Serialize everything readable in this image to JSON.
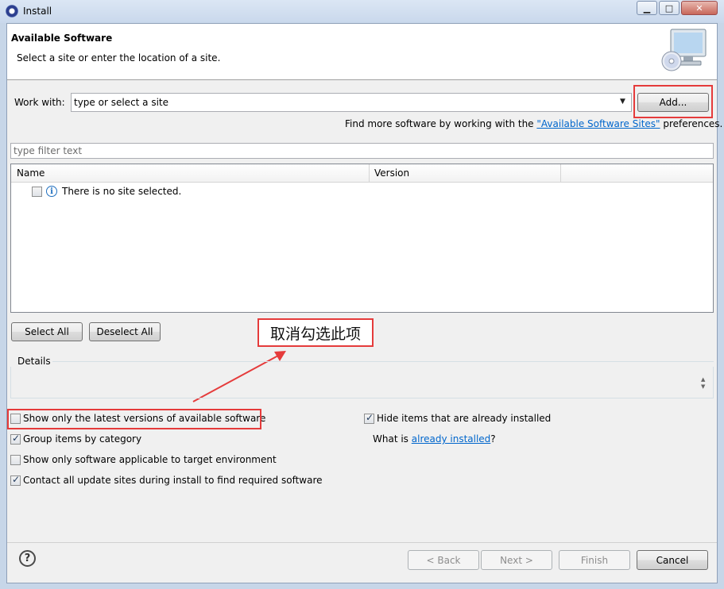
{
  "window": {
    "title": "Install"
  },
  "header": {
    "title": "Available Software",
    "description": "Select a site or enter the location of a site."
  },
  "work_with": {
    "label": "Work with:",
    "value": "type or select a site",
    "add_button": "Add..."
  },
  "find_more": {
    "prefix": "Find more software by working with the ",
    "link": "\"Available Software Sites\"",
    "suffix": " preferences."
  },
  "filter": {
    "placeholder": "type filter text"
  },
  "table": {
    "columns": [
      "Name",
      "Version"
    ],
    "rows": [
      {
        "name": "There is no site selected.",
        "checked": false
      }
    ]
  },
  "buttons": {
    "select_all": "Select All",
    "deselect_all": "Deselect All"
  },
  "annotation": {
    "text": "取消勾选此项"
  },
  "details": {
    "label": "Details"
  },
  "options": {
    "show_latest": {
      "label": "Show only the latest versions of available software",
      "checked": false
    },
    "group_by_category": {
      "label": "Group items by category",
      "checked": true
    },
    "show_applicable": {
      "label": "Show only software applicable to target environment",
      "checked": false
    },
    "contact_sites": {
      "label": "Contact all update sites during install to find required software",
      "checked": true
    },
    "hide_installed": {
      "label": "Hide items that are already installed",
      "checked": true
    },
    "what_is": {
      "prefix": "What is ",
      "link": "already installed",
      "suffix": "?"
    }
  },
  "footer": {
    "back": "< Back",
    "next": "Next >",
    "finish": "Finish",
    "cancel": "Cancel"
  },
  "colors": {
    "highlight": "#e53b3b",
    "link": "#0066cc",
    "dialog_bg": "#f0f0f0"
  }
}
